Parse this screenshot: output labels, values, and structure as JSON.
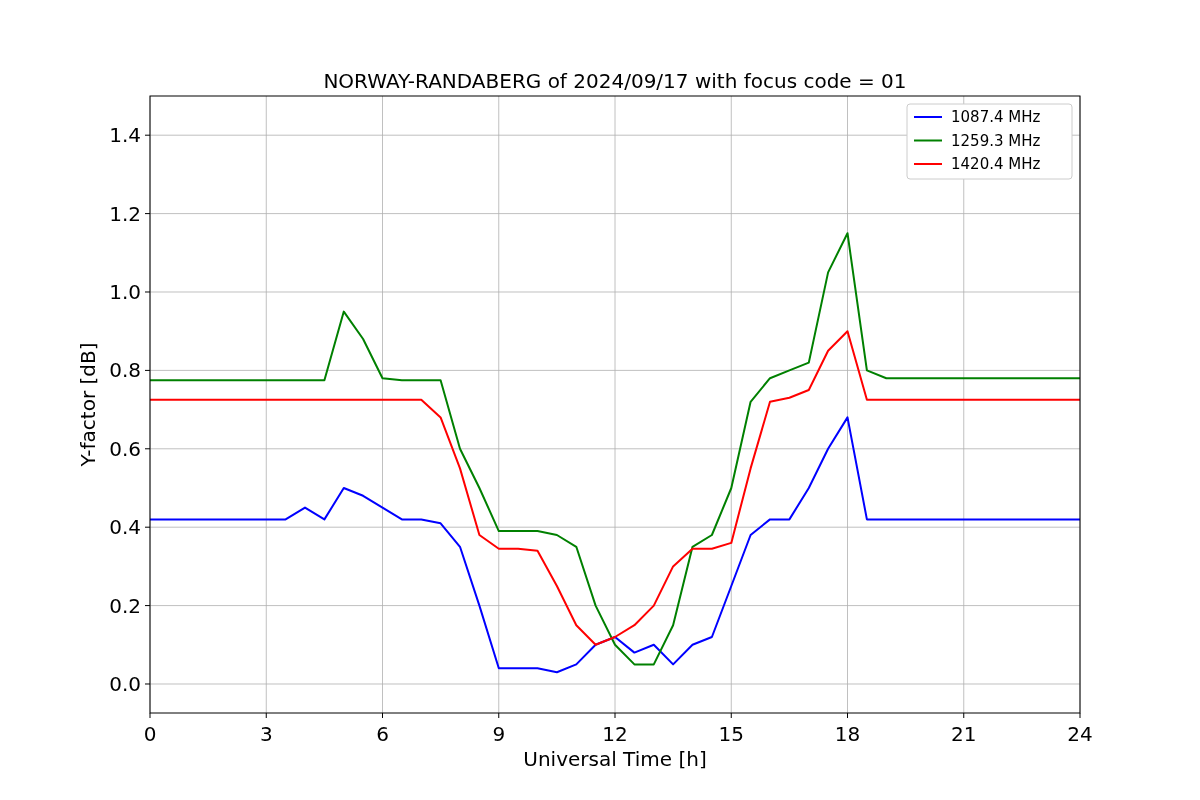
{
  "chart_data": {
    "type": "line",
    "title": "NORWAY-RANDABERG of 2024/09/17 with focus code = 01",
    "xlabel": "Universal Time [h]",
    "ylabel": "Y-factor [dB]",
    "x": [
      0,
      0.5,
      1,
      1.5,
      2,
      2.5,
      3,
      3.5,
      4,
      4.5,
      5,
      5.5,
      6,
      6.5,
      7,
      7.5,
      8,
      8.5,
      9,
      9.5,
      10,
      10.5,
      11,
      11.5,
      12,
      12.5,
      13,
      13.5,
      14,
      14.5,
      15,
      15.5,
      16,
      16.5,
      17,
      17.5,
      18,
      18.5,
      19,
      19.5,
      20,
      20.5,
      21,
      21.5,
      22,
      22.5,
      23,
      23.5,
      24
    ],
    "series": [
      {
        "name": "1087.4 MHz",
        "color": "#0000ff",
        "values": [
          0.42,
          0.42,
          0.42,
          0.42,
          0.42,
          0.42,
          0.42,
          0.42,
          0.45,
          0.42,
          0.5,
          0.48,
          0.45,
          0.42,
          0.42,
          0.41,
          0.35,
          0.2,
          0.04,
          0.04,
          0.04,
          0.03,
          0.05,
          0.1,
          0.12,
          0.08,
          0.1,
          0.05,
          0.1,
          0.12,
          0.25,
          0.38,
          0.42,
          0.42,
          0.5,
          0.6,
          0.68,
          0.42,
          0.42,
          0.42,
          0.42,
          0.42,
          0.42,
          0.42,
          0.42,
          0.42,
          0.42,
          0.42,
          0.42
        ]
      },
      {
        "name": "1259.3 MHz",
        "color": "#008000",
        "values": [
          0.775,
          0.775,
          0.775,
          0.775,
          0.775,
          0.775,
          0.775,
          0.775,
          0.775,
          0.775,
          0.95,
          0.88,
          0.78,
          0.775,
          0.775,
          0.775,
          0.6,
          0.5,
          0.39,
          0.39,
          0.39,
          0.38,
          0.35,
          0.2,
          0.1,
          0.05,
          0.05,
          0.15,
          0.35,
          0.38,
          0.5,
          0.72,
          0.78,
          0.8,
          0.82,
          1.05,
          1.15,
          0.8,
          0.78,
          0.78,
          0.78,
          0.78,
          0.78,
          0.78,
          0.78,
          0.78,
          0.78,
          0.78,
          0.78
        ]
      },
      {
        "name": "1420.4 MHz",
        "color": "#ff0000",
        "values": [
          0.725,
          0.725,
          0.725,
          0.725,
          0.725,
          0.725,
          0.725,
          0.725,
          0.725,
          0.725,
          0.725,
          0.725,
          0.725,
          0.725,
          0.725,
          0.68,
          0.55,
          0.38,
          0.345,
          0.345,
          0.34,
          0.25,
          0.15,
          0.1,
          0.12,
          0.15,
          0.2,
          0.3,
          0.345,
          0.345,
          0.36,
          0.55,
          0.72,
          0.73,
          0.75,
          0.85,
          0.9,
          0.725,
          0.725,
          0.725,
          0.725,
          0.725,
          0.725,
          0.725,
          0.725,
          0.725,
          0.725,
          0.725,
          0.725
        ]
      }
    ],
    "grid": true,
    "legend": true,
    "xlim": [
      0,
      24
    ],
    "ylim": [
      -0.074,
      1.5
    ],
    "xticks": [
      0,
      3,
      6,
      9,
      12,
      15,
      18,
      21,
      24
    ],
    "yticks": [
      {
        "value": 0,
        "label": "0.0"
      },
      {
        "value": 0.2,
        "label": "0.2"
      },
      {
        "value": 0.4,
        "label": "0.4"
      },
      {
        "value": 0.6,
        "label": "0.6"
      },
      {
        "value": 0.8,
        "label": "0.8"
      },
      {
        "value": 1,
        "label": "1.0"
      },
      {
        "value": 1.2,
        "label": "1.2"
      },
      {
        "value": 1.4,
        "label": "1.4"
      }
    ]
  }
}
